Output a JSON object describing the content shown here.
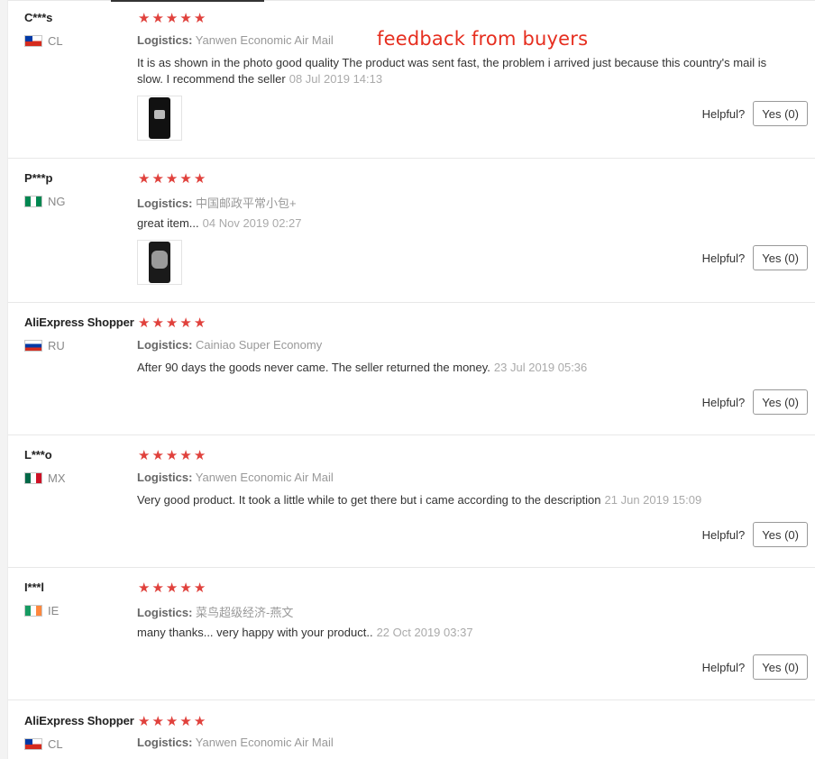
{
  "annotation": "feedback from buyers",
  "helpful_label": "Helpful?",
  "logistics_label": "Logistics:",
  "reviews": [
    {
      "user": "C***s",
      "country": "CL",
      "stars": 5,
      "logistics": "Yanwen Economic Air Mail",
      "comment": "It is as shown in the photo good quality The product was sent fast, the problem i arrived just because this country's mail is slow. I recommend the seller",
      "date": "08 Jul 2019 14:13",
      "has_photo": true,
      "yes_label": "Yes (0)"
    },
    {
      "user": "P***p",
      "country": "NG",
      "stars": 5,
      "logistics": "中国邮政平常小包+",
      "comment": "great item...",
      "date": "04 Nov 2019 02:27",
      "has_photo": true,
      "yes_label": "Yes (0)"
    },
    {
      "user": "AliExpress Shopper",
      "country": "RU",
      "stars": 5,
      "logistics": "Cainiao Super Economy",
      "comment": "After 90 days the goods never came. The seller returned the money.",
      "date": "23 Jul 2019 05:36",
      "has_photo": false,
      "yes_label": "Yes (0)"
    },
    {
      "user": "L***o",
      "country": "MX",
      "stars": 5,
      "logistics": "Yanwen Economic Air Mail",
      "comment": "Very good product. It took a little while to get there but i came according to the description",
      "date": "21 Jun 2019 15:09",
      "has_photo": false,
      "yes_label": "Yes (0)"
    },
    {
      "user": "I***l",
      "country": "IE",
      "stars": 5,
      "logistics": "菜鸟超级经济-燕文",
      "comment": "many thanks... very happy with your product..",
      "date": "22 Oct 2019 03:37",
      "has_photo": false,
      "yes_label": "Yes (0)"
    },
    {
      "user": "AliExpress Shopper",
      "country": "CL",
      "stars": 5,
      "logistics": "Yanwen Economic Air Mail"
    }
  ]
}
